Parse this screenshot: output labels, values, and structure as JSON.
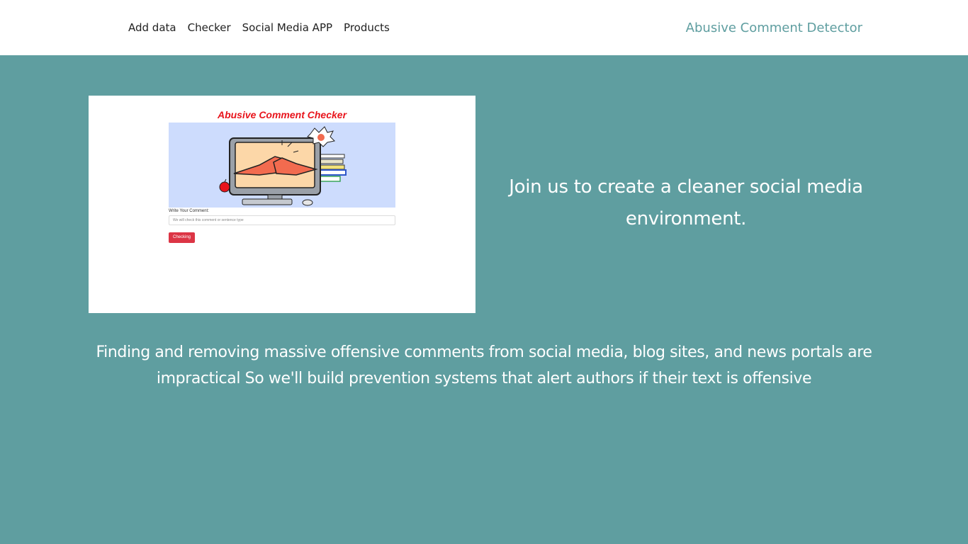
{
  "nav": {
    "links": [
      {
        "label": "Add data"
      },
      {
        "label": "Checker"
      },
      {
        "label": "Social Media APP"
      },
      {
        "label": "Products"
      }
    ],
    "brand": "Abusive Comment Detector"
  },
  "hero": {
    "mock": {
      "title": "Abusive Comment Checker",
      "label": "Write Your Comment:",
      "input_placeholder": "We will check this comment or sentence type",
      "button_label": "Checking"
    },
    "tagline": "Join us to create a cleaner social media environment."
  },
  "description": "Finding and removing massive offensive comments from social media, blog sites, and news portals are impractical So we'll build prevention systems that alert authors if their text is offensive",
  "colors": {
    "background": "#5f9ea0",
    "brand": "#5f9ea0",
    "mock_title": "#e8141c",
    "mock_button": "#dc3545"
  }
}
